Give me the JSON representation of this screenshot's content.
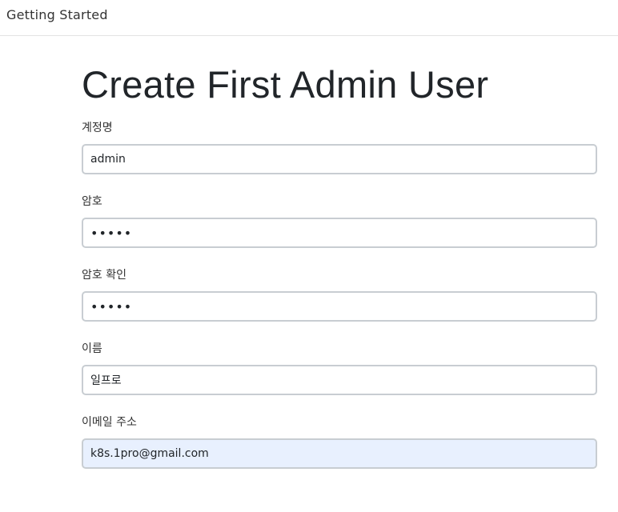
{
  "header": {
    "title": "Getting Started"
  },
  "page": {
    "title": "Create First Admin User"
  },
  "form": {
    "username": {
      "label": "계정명",
      "value": "admin"
    },
    "password": {
      "label": "암호",
      "value": "•••••"
    },
    "confirm_password": {
      "label": "암호 확인",
      "value": "•••••"
    },
    "fullname": {
      "label": "이름",
      "value": "일프로"
    },
    "email": {
      "label": "이메일 주소",
      "value": "k8s.1pro@gmail.com"
    }
  }
}
